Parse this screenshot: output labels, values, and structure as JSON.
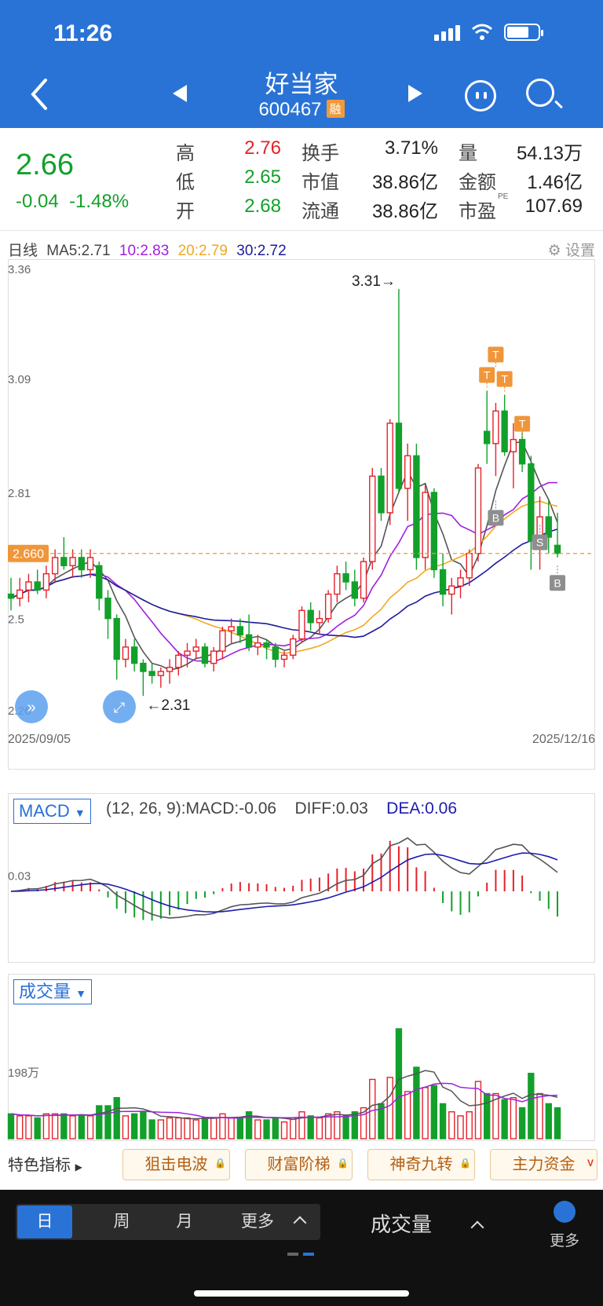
{
  "status_bar": {
    "time": "11:26"
  },
  "header": {
    "title": "好当家",
    "code": "600467",
    "margin_badge": "融"
  },
  "quote": {
    "price": "2.66",
    "change": "-0.04",
    "change_pct": "-1.48%",
    "rows": [
      [
        {
          "label": "高",
          "value": "2.76",
          "color": "red"
        },
        {
          "label": "换手",
          "value": "3.71%",
          "color": "dark"
        },
        {
          "label": "量",
          "value": "54.13万",
          "color": "dark"
        }
      ],
      [
        {
          "label": "低",
          "value": "2.65",
          "color": "green"
        },
        {
          "label": "市值",
          "value": "38.86亿",
          "color": "dark"
        },
        {
          "label": "金额",
          "value": "1.46亿",
          "color": "dark"
        }
      ],
      [
        {
          "label": "开",
          "value": "2.68",
          "color": "green"
        },
        {
          "label": "流通",
          "value": "38.86亿",
          "color": "dark"
        },
        {
          "label": "市盈",
          "value": "107.69",
          "color": "dark",
          "sup": "PE"
        }
      ]
    ]
  },
  "kline": {
    "period_label": "日线",
    "ma": [
      {
        "text": "MA5:2.71",
        "color": "#444444"
      },
      {
        "text": "10:2.83",
        "color": "#a020e0"
      },
      {
        "text": "20:2.79",
        "color": "#f0a820"
      },
      {
        "text": "30:2.72",
        "color": "#1c1c9c"
      }
    ],
    "settings_label": "设置",
    "y_ticks": [
      "3.36",
      "3.09",
      "2.81",
      "2.5",
      "2.26"
    ],
    "current_price_label": "2.660",
    "high_annotation": "3.31→",
    "low_annotation": "←2.31",
    "start_date": "2025/09/05",
    "end_date": "2025/12/16",
    "signals": {
      "t": "T",
      "b": "B",
      "s": "S"
    }
  },
  "macd": {
    "selector": "MACD",
    "params": "(12, 26, 9):MACD:-0.06",
    "diff": "DIFF:0.03",
    "dea": "DEA:0.06",
    "y_tick": "0.03"
  },
  "volume": {
    "selector": "成交量",
    "y_tick": "198万"
  },
  "feature_tabs": {
    "first": "特色指标",
    "items": [
      "狙击电波",
      "财富阶梯",
      "神奇九转",
      "主力资金"
    ]
  },
  "bottom_bar": {
    "periods": [
      "日",
      "周",
      "月",
      "更多"
    ],
    "indicator": "成交量",
    "more": "更多"
  },
  "colors": {
    "up": "#e5212a",
    "down": "#12a02a",
    "accent": "#2a73d6"
  },
  "chart_data": {
    "type": "candlestick",
    "x_start": "2025/09/05",
    "x_end": "2025/12/16",
    "ylim": [
      2.26,
      3.36
    ],
    "series": [
      {
        "name": "MA5",
        "value": 2.71
      },
      {
        "name": "10",
        "value": 2.83
      },
      {
        "name": "20",
        "value": 2.79
      },
      {
        "name": "30",
        "value": 2.72
      }
    ],
    "ohlc": [
      [
        2.56,
        2.6,
        2.52,
        2.55
      ],
      [
        2.55,
        2.6,
        2.53,
        2.57
      ],
      [
        2.57,
        2.61,
        2.54,
        2.59
      ],
      [
        2.59,
        2.62,
        2.56,
        2.57
      ],
      [
        2.57,
        2.63,
        2.55,
        2.61
      ],
      [
        2.61,
        2.67,
        2.59,
        2.65
      ],
      [
        2.65,
        2.7,
        2.62,
        2.63
      ],
      [
        2.63,
        2.67,
        2.6,
        2.65
      ],
      [
        2.65,
        2.67,
        2.6,
        2.62
      ],
      [
        2.62,
        2.67,
        2.6,
        2.65
      ],
      [
        2.63,
        2.64,
        2.52,
        2.55
      ],
      [
        2.55,
        2.57,
        2.45,
        2.5
      ],
      [
        2.5,
        2.51,
        2.35,
        2.4
      ],
      [
        2.4,
        2.45,
        2.38,
        2.43
      ],
      [
        2.43,
        2.45,
        2.37,
        2.39
      ],
      [
        2.39,
        2.4,
        2.31,
        2.37
      ],
      [
        2.37,
        2.39,
        2.34,
        2.36
      ],
      [
        2.36,
        2.38,
        2.33,
        2.37
      ],
      [
        2.37,
        2.4,
        2.34,
        2.38
      ],
      [
        2.38,
        2.42,
        2.36,
        2.41
      ],
      [
        2.41,
        2.44,
        2.38,
        2.42
      ],
      [
        2.42,
        2.45,
        2.4,
        2.43
      ],
      [
        2.43,
        2.44,
        2.38,
        2.39
      ],
      [
        2.39,
        2.43,
        2.37,
        2.42
      ],
      [
        2.42,
        2.48,
        2.4,
        2.47
      ],
      [
        2.47,
        2.5,
        2.44,
        2.48
      ],
      [
        2.48,
        2.5,
        2.44,
        2.46
      ],
      [
        2.46,
        2.51,
        2.42,
        2.43
      ],
      [
        2.43,
        2.46,
        2.41,
        2.44
      ],
      [
        2.44,
        2.45,
        2.4,
        2.43
      ],
      [
        2.43,
        2.44,
        2.38,
        2.4
      ],
      [
        2.4,
        2.42,
        2.38,
        2.41
      ],
      [
        2.41,
        2.46,
        2.4,
        2.45
      ],
      [
        2.45,
        2.53,
        2.44,
        2.52
      ],
      [
        2.52,
        2.54,
        2.47,
        2.49
      ],
      [
        2.49,
        2.52,
        2.46,
        2.5
      ],
      [
        2.5,
        2.57,
        2.49,
        2.56
      ],
      [
        2.56,
        2.63,
        2.54,
        2.61
      ],
      [
        2.61,
        2.64,
        2.57,
        2.59
      ],
      [
        2.59,
        2.62,
        2.53,
        2.55
      ],
      [
        2.55,
        2.65,
        2.54,
        2.64
      ],
      [
        2.64,
        2.87,
        2.62,
        2.85
      ],
      [
        2.85,
        2.87,
        2.74,
        2.76
      ],
      [
        2.76,
        2.99,
        2.73,
        2.98
      ],
      [
        2.98,
        3.31,
        2.81,
        2.82
      ],
      [
        2.82,
        2.93,
        2.74,
        2.9
      ],
      [
        2.9,
        2.93,
        2.62,
        2.65
      ],
      [
        2.65,
        2.83,
        2.62,
        2.81
      ],
      [
        2.81,
        2.82,
        2.6,
        2.62
      ],
      [
        2.62,
        2.66,
        2.53,
        2.56
      ],
      [
        2.56,
        2.6,
        2.51,
        2.58
      ],
      [
        2.58,
        2.62,
        2.55,
        2.6
      ],
      [
        2.6,
        2.67,
        2.58,
        2.66
      ],
      [
        2.66,
        2.88,
        2.64,
        2.87
      ],
      [
        2.96,
        3.06,
        2.88,
        2.93
      ],
      [
        2.93,
        3.03,
        2.85,
        3.01
      ],
      [
        3.01,
        3.05,
        2.9,
        2.91
      ],
      [
        2.91,
        2.98,
        2.82,
        2.94
      ],
      [
        2.94,
        2.97,
        2.86,
        2.88
      ],
      [
        2.88,
        2.9,
        2.62,
        2.69
      ],
      [
        2.69,
        2.8,
        2.62,
        2.75
      ],
      [
        2.75,
        2.79,
        2.66,
        2.7
      ],
      [
        2.68,
        2.76,
        2.65,
        2.66
      ]
    ]
  }
}
